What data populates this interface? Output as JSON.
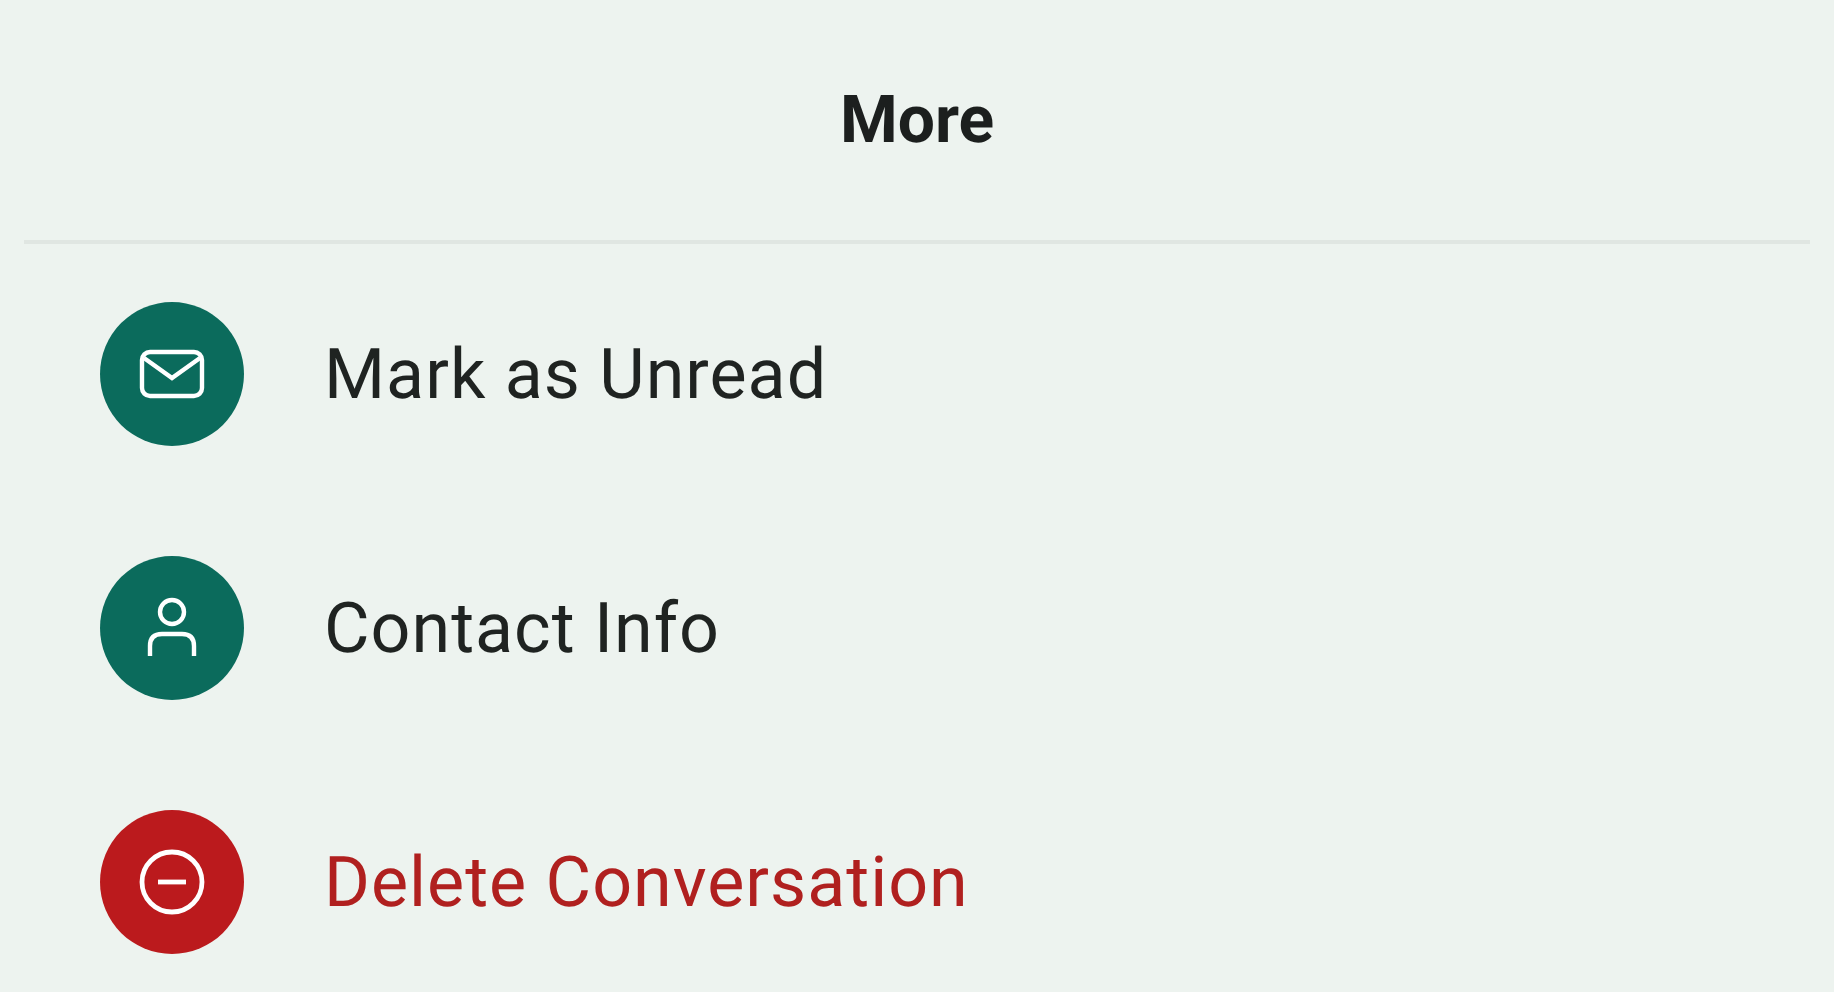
{
  "sheet": {
    "title": "More"
  },
  "items": [
    {
      "kind": "mail",
      "label": "Mark as Unread",
      "destructive": false
    },
    {
      "kind": "person",
      "label": "Contact Info",
      "destructive": false
    },
    {
      "kind": "delete",
      "label": "Delete Conversation",
      "destructive": true
    }
  ]
}
